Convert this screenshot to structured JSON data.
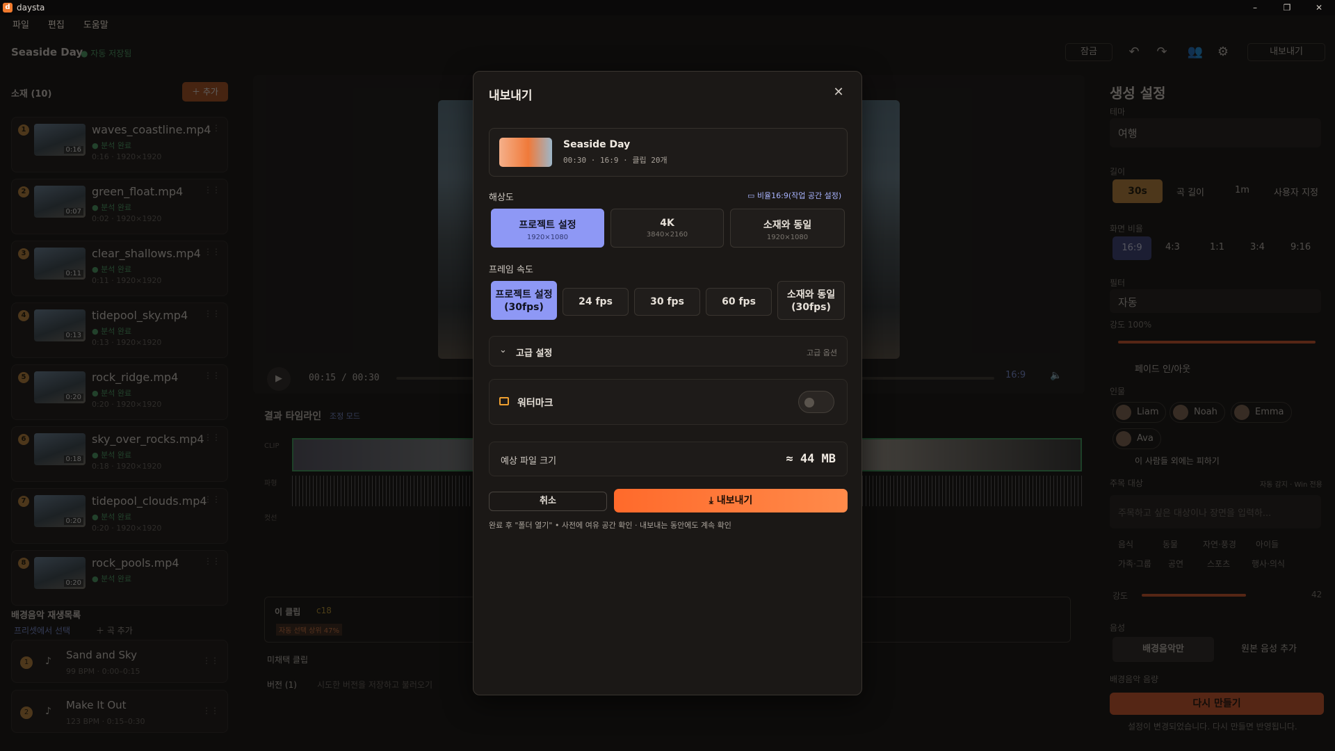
{
  "window": {
    "title": "daysta",
    "min": "–",
    "max": "❐",
    "close": "✕"
  },
  "menu": [
    "파일",
    "편집",
    "도움말"
  ],
  "header": {
    "project": "Seaside Day",
    "autosave": "● 자동 저장됨",
    "lock": "잠금",
    "export": "내보내기"
  },
  "sidebar": {
    "clips_title": "소재 (10)",
    "add": "＋ 추가",
    "clips": [
      {
        "n": "1",
        "name": "waves_coastline.mp4",
        "status": "● 분석 완료",
        "meta": "0:16 · 1920×1920",
        "dur": "0:16"
      },
      {
        "n": "2",
        "name": "green_float.mp4",
        "status": "● 분석 완료",
        "meta": "0:02 · 1920×1920",
        "dur": "0:07"
      },
      {
        "n": "3",
        "name": "clear_shallows.mp4",
        "status": "● 분석 완료",
        "meta": "0:11 · 1920×1920",
        "dur": "0:11"
      },
      {
        "n": "4",
        "name": "tidepool_sky.mp4",
        "status": "● 분석 완료",
        "meta": "0:13 · 1920×1920",
        "dur": "0:13"
      },
      {
        "n": "5",
        "name": "rock_ridge.mp4",
        "status": "● 분석 완료",
        "meta": "0:20 · 1920×1920",
        "dur": "0:20"
      },
      {
        "n": "6",
        "name": "sky_over_rocks.mp4",
        "status": "● 분석 완료",
        "meta": "0:18 · 1920×1920",
        "dur": "0:18"
      },
      {
        "n": "7",
        "name": "tidepool_clouds.mp4",
        "status": "● 분석 완료",
        "meta": "0:20 · 1920×1920",
        "dur": "0:20"
      },
      {
        "n": "8",
        "name": "rock_pools.mp4",
        "status": "● 분석 완료",
        "meta": "",
        "dur": "0:20"
      }
    ],
    "music_title": "배경음악 재생목록",
    "music_preset": "프리셋에서 선택",
    "music_add": "＋ 곡 추가",
    "songs": [
      {
        "n": "1",
        "title": "Sand and Sky",
        "meta": "99 BPM · 0:00–0:15"
      },
      {
        "n": "2",
        "title": "Make It Out",
        "meta": "123 BPM · 0:15–0:30"
      }
    ]
  },
  "player": {
    "time": "00:15 / 00:30",
    "ratio": "16:9",
    "play": "▶",
    "volume": "🔈"
  },
  "timeline": {
    "title": "결과 타임라인",
    "mode": "조정 모드",
    "row1": "CLIP",
    "row2": "파형",
    "row3": "컷선",
    "this_clip": "이 클립",
    "clip_id": "c18",
    "auto_badge": "자동 선택 상위 47%",
    "unused": "미채택 클립",
    "versions": "버전 (1)",
    "versions_hint": "시도한 버전을 저장하고 불러오기"
  },
  "right_panel": {
    "title": "생성 설정",
    "theme_label": "테마",
    "theme": "여행",
    "length_label": "길이",
    "lengths": [
      "30s",
      "곡 길이",
      "1m",
      "사용자 지정"
    ],
    "ratio_label": "화면 비율",
    "ratios": [
      "16:9",
      "4:3",
      "1:1",
      "3:4",
      "9:16"
    ],
    "filter_label": "필터",
    "filter": "자동",
    "strength": "강도 100%",
    "fade": "페이드 인/아웃",
    "people_label": "인물",
    "people": [
      "Liam",
      "Noah",
      "Emma",
      "Ava"
    ],
    "avoid": "이 사람들 외에는 피하기",
    "focus_label": "주목 대상",
    "focus_right": "자동 감지 · Win 전용",
    "focus_placeholder": "주목하고 싶은 대상이나 장면을 입력하...",
    "tags": [
      "음식",
      "동물",
      "자연·풍경",
      "아이들",
      "가족·그룹",
      "공연",
      "스포츠",
      "행사·의식"
    ],
    "intensity": "강도",
    "intensity_value": "42",
    "audio_label": "음성",
    "audio_opts": [
      "배경음악만",
      "원본 음성 추가"
    ],
    "bgm_vol": "배경음악 음량",
    "regen": "다시 만들기",
    "regen_hint": "설정이 변경되었습니다. 다시 만들면 반영됩니다."
  },
  "modal": {
    "title": "내보내기",
    "close": "✕",
    "project": {
      "name": "Seaside Day",
      "meta": "00:30 · 16:9 · 클립 20개"
    },
    "resolution_label": "해상도",
    "ratio_hint": "▭ 비율16:9(작업 공간 설정)",
    "resolutions": [
      {
        "label": "프로젝트 설정",
        "sub": "1920×1080"
      },
      {
        "label": "4K",
        "sub": "3840×2160"
      },
      {
        "label": "소재와 동일",
        "sub": "1920×1080"
      }
    ],
    "fps_label": "프레임 속도",
    "fps": [
      "프로젝트 설정 (30fps)",
      "24 fps",
      "30 fps",
      "60 fps",
      "소재와 동일 (30fps)"
    ],
    "advanced": "고급 설정",
    "advanced_right": "고급 옵션",
    "watermark": "워터마크",
    "filesize_label": "예상 파일 크기",
    "filesize": "≈ 44 MB",
    "cancel": "취소",
    "export": "내보내기",
    "footnote": "완료 후 \"폴더 열기\" • 사전에 여유 공간 확인 · 내보내는 동안에도 계속 확인"
  }
}
